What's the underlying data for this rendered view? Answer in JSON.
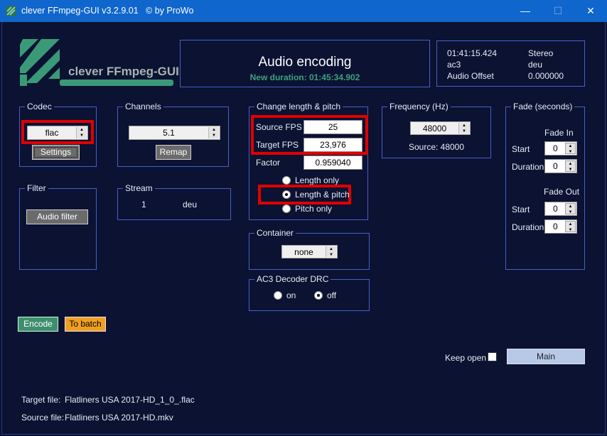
{
  "window": {
    "title": "clever FFmpeg-GUI v3.2.9.01   © by ProWo",
    "minimize": "—",
    "maximize": "☐",
    "close": "✕"
  },
  "logo": {
    "text": "clever FFmpeg-GUI"
  },
  "header": {
    "title": "Audio encoding",
    "new_duration": "New duration: 01:45:34.902"
  },
  "info": {
    "duration": "01:41:15.424",
    "layout": "Stereo",
    "codec": "ac3",
    "language": "deu",
    "offset_label": "Audio Offset",
    "offset_value": "0.000000"
  },
  "codec": {
    "legend": "Codec",
    "value": "flac",
    "settings": "Settings"
  },
  "channels": {
    "legend": "Channels",
    "value": "5.1",
    "remap": "Remap"
  },
  "filter": {
    "legend": "Filter",
    "audio_filter": "Audio filter"
  },
  "stream": {
    "legend": "Stream",
    "index": "1",
    "language": "deu"
  },
  "change": {
    "legend": "Change length & pitch",
    "source_fps_label": "Source FPS",
    "source_fps": "25",
    "target_fps_label": "Target FPS",
    "target_fps": "23,976",
    "factor_label": "Factor",
    "factor": "0.959040",
    "options": [
      "Length only",
      "Length & pitch",
      "Pitch only"
    ],
    "selected": "Length & pitch"
  },
  "frequency": {
    "legend": "Frequency (Hz)",
    "value": "48000",
    "source": "Source: 48000"
  },
  "container": {
    "legend": "Container",
    "value": "none"
  },
  "ac3drc": {
    "legend": "AC3 Decoder DRC",
    "on": "on",
    "off": "off",
    "selected": "off"
  },
  "fade": {
    "legend": "Fade (seconds)",
    "fade_in": "Fade In",
    "fade_out": "Fade Out",
    "start": "Start",
    "duration": "Duration",
    "in_start": "0",
    "in_duration": "0",
    "out_start": "0",
    "out_duration": "0"
  },
  "actions": {
    "encode": "Encode",
    "to_batch": "To batch",
    "keep_open": "Keep open",
    "main": "Main"
  },
  "files": {
    "target_label": "Target file:",
    "target": "Flatliners USA 2017-HD_1_0_.flac",
    "source_label": "Source file:",
    "source": "Flatliners USA 2017-HD.mkv"
  },
  "colors": {
    "background": "#0b1232",
    "titlebar": "#0f66cc",
    "accent_green": "#3fa080",
    "highlight_red": "#e00000",
    "batch_orange": "#f0a020"
  }
}
